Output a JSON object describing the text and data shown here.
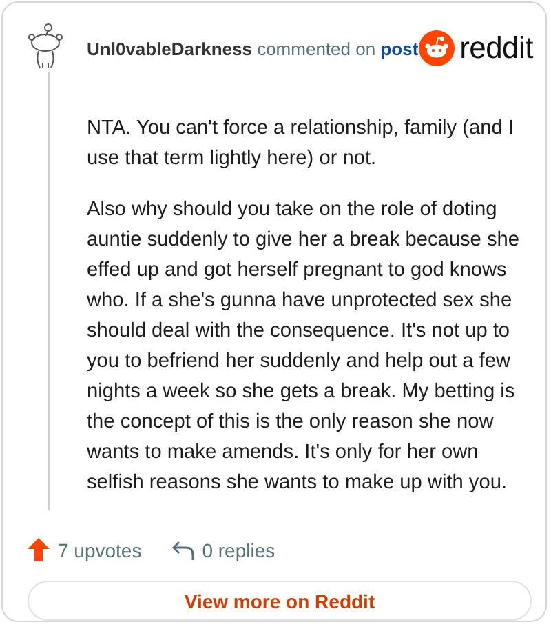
{
  "comment": {
    "author": "Unl0vableDarkness",
    "action": "commented on",
    "link": "post",
    "brand": "reddit",
    "paragraphs": [
      "NTA. You can't force a relationship, family (and I use that term lightly here) or not.",
      "Also why should you take on the role of doting auntie suddenly to give her a break because she effed up and got herself pregnant to god knows who. If a she's gunna have unprotected sex she should deal with the consequence. It's not up to you to befriend her suddenly and help out a few nights a week so she gets a break. My betting is the concept of this is the only reason she now wants to make amends. It's only for her own selfish reasons she wants to make up with you."
    ],
    "upvotes": "7 upvotes",
    "replies": "0 replies",
    "button": "View more on Reddit"
  }
}
